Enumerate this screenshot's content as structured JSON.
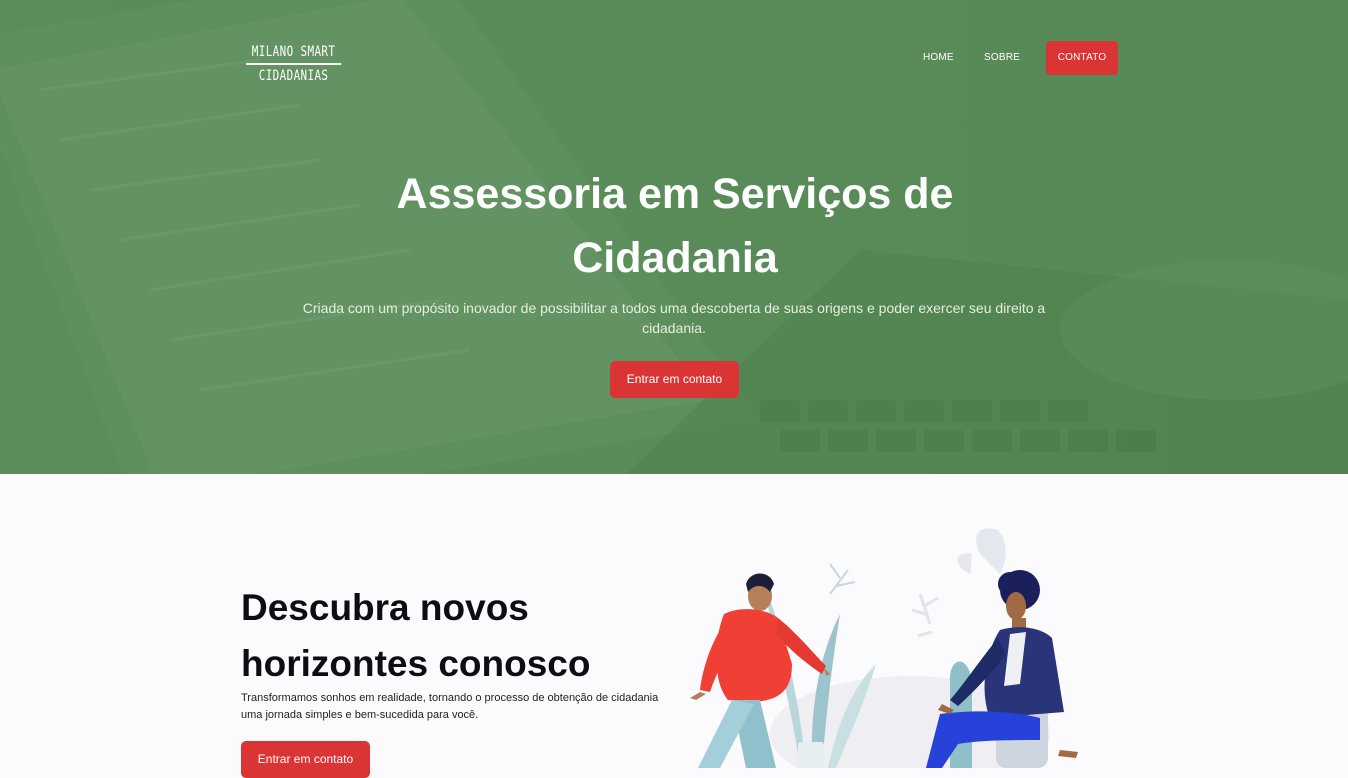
{
  "logo": {
    "line1": "MILANO SMART",
    "line2": "CIDADANIAS"
  },
  "nav": {
    "home": "HOME",
    "sobre": "SOBRE",
    "contato": "CONTATO"
  },
  "hero": {
    "title": "Assessoria em Serviços de Cidadania",
    "subtitle": "Criada com um propósito inovador de possibilitar a todos uma descoberta de suas origens e poder exercer seu direito a cidadania.",
    "cta": "Entrar em contato"
  },
  "section": {
    "title": "Descubra novos horizontes conosco",
    "text": "Transformamos sonhos em realidade, tornando o processo de obtenção de cidadania uma jornada simples e bem-sucedida para você.",
    "cta": "Entrar em contato"
  },
  "colors": {
    "hero_overlay": "#5a8d5a",
    "accent": "#db3434",
    "heading": "#0d0d14",
    "background": "#fbfbfd"
  },
  "icons": {
    "hero_background": "laptop-photo",
    "illustration": "two-people-conversation-illustration"
  }
}
